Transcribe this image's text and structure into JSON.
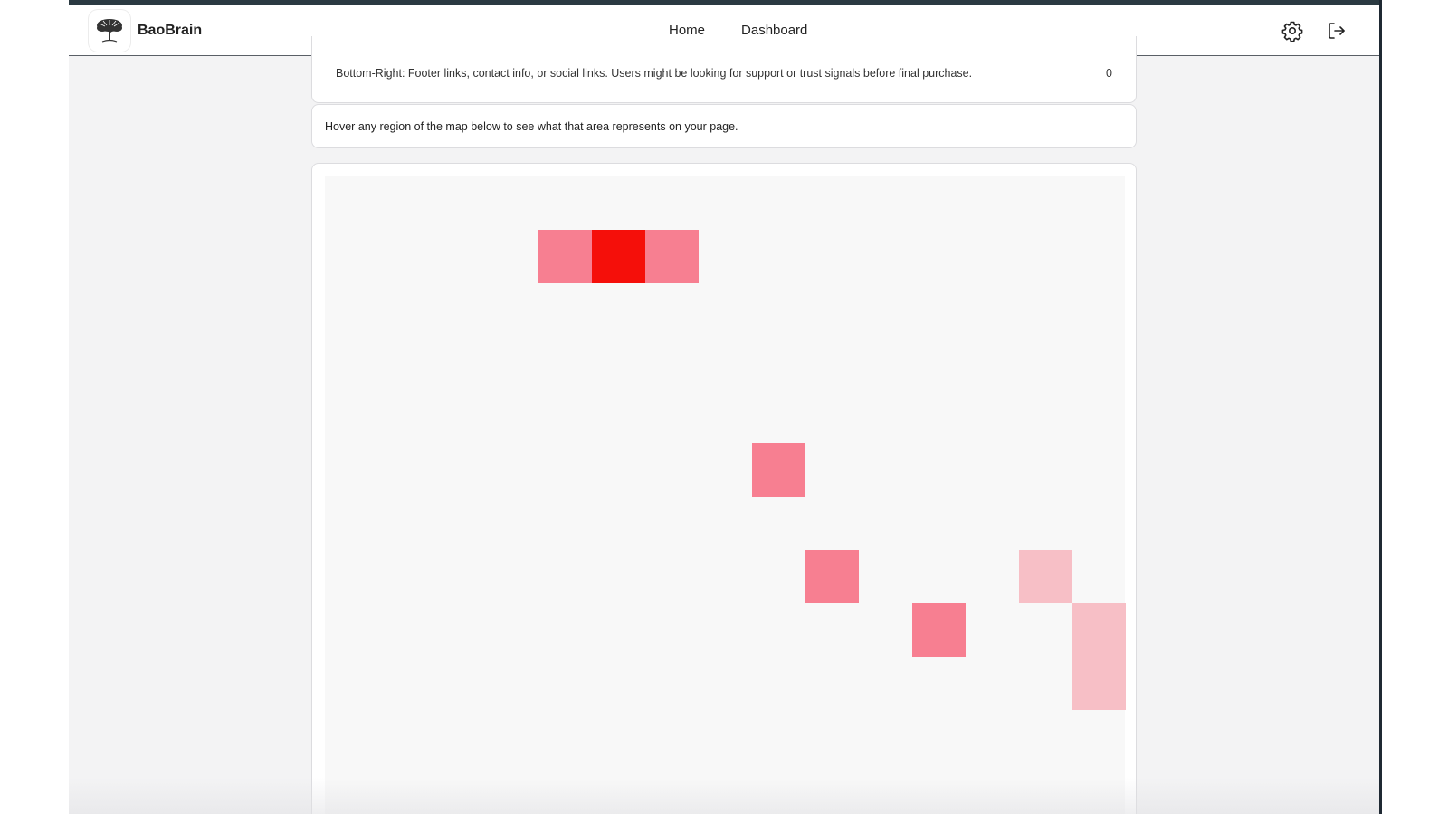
{
  "app": {
    "name": "BaoBrain",
    "logo_icon": "tree-icon"
  },
  "nav": {
    "links": [
      {
        "label": "Home"
      },
      {
        "label": "Dashboard"
      }
    ],
    "settings_icon": "gear-icon",
    "logout_icon": "logout-icon"
  },
  "regions_table": {
    "last_row": {
      "description": "Bottom-Right: Footer links, contact info, or social links. Users might be looking for support or trust signals before final purchase.",
      "count": "0"
    }
  },
  "heatmap": {
    "hint": "Hover any region of the map below to see what that area represents on your page.",
    "background_color": "#f8f8f8",
    "intensity_colors": {
      "high": "#f50f0a",
      "medium": "#f77f91",
      "low": "#f7bfc6"
    },
    "cells": [
      {
        "col": 4,
        "row": 1,
        "level": "medium"
      },
      {
        "col": 5,
        "row": 1,
        "level": "high"
      },
      {
        "col": 6,
        "row": 1,
        "level": "medium"
      },
      {
        "col": 8,
        "row": 5,
        "level": "medium"
      },
      {
        "col": 9,
        "row": 7,
        "level": "medium"
      },
      {
        "col": 13,
        "row": 7,
        "level": "low"
      },
      {
        "col": 11,
        "row": 8,
        "level": "medium"
      },
      {
        "col": 14,
        "row": 8,
        "level": "low"
      },
      {
        "col": 14,
        "row": 9,
        "level": "low"
      }
    ]
  }
}
